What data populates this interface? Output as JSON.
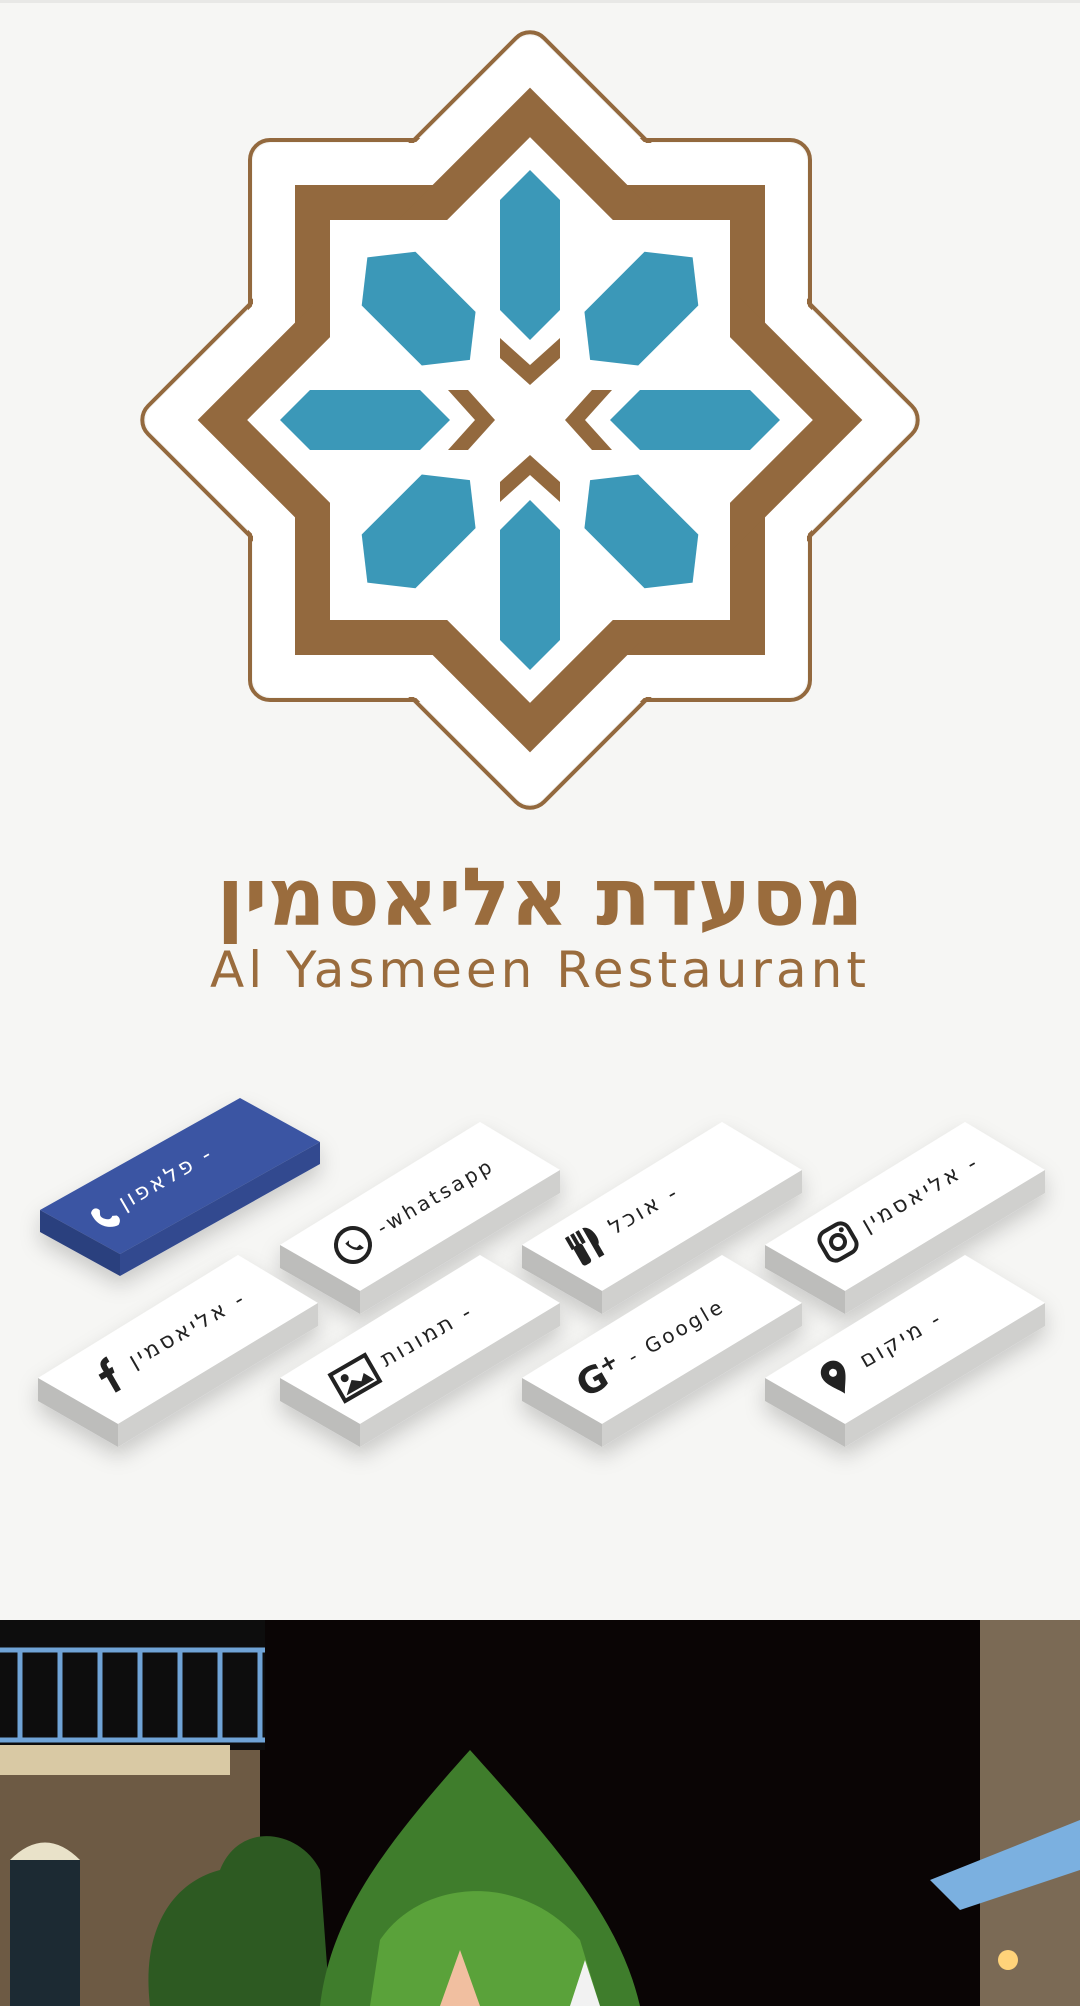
{
  "logo": {
    "name": "al-yasmeen-star-logo",
    "colors": {
      "brown": "#93693e",
      "blue": "#3b98b8",
      "white": "#ffffff"
    }
  },
  "title": {
    "hebrew": "מסעדת אליאסמין",
    "english": "Al Yasmeen Restaurant",
    "color": "#9a6c3d"
  },
  "buttons": [
    {
      "id": "phone",
      "label": "פלאפון -",
      "icon": "phone-icon",
      "active": true
    },
    {
      "id": "whatsapp",
      "label": "-whatsapp",
      "icon": "whatsapp-icon",
      "active": false
    },
    {
      "id": "menu",
      "label": "אוכל -",
      "icon": "fork-knife-icon",
      "active": false
    },
    {
      "id": "instagram",
      "label": "אליאסמין -",
      "icon": "instagram-icon",
      "active": false
    },
    {
      "id": "facebook",
      "label": "אליאסמין -",
      "icon": "facebook-icon",
      "active": false
    },
    {
      "id": "gallery",
      "label": "תמונות -",
      "icon": "image-icon",
      "active": false
    },
    {
      "id": "google",
      "label": "- Google",
      "icon": "google-plus-icon",
      "active": false
    },
    {
      "id": "location",
      "label": "מיקום -",
      "icon": "map-pin-icon",
      "active": false
    }
  ],
  "colors": {
    "active_tile": "#3b55a3",
    "tile": "#ffffff",
    "tile_side": "#c7c7c5",
    "background": "#f6f6f4"
  },
  "photo": {
    "description_icon": "restaurant-courtyard-photo"
  }
}
